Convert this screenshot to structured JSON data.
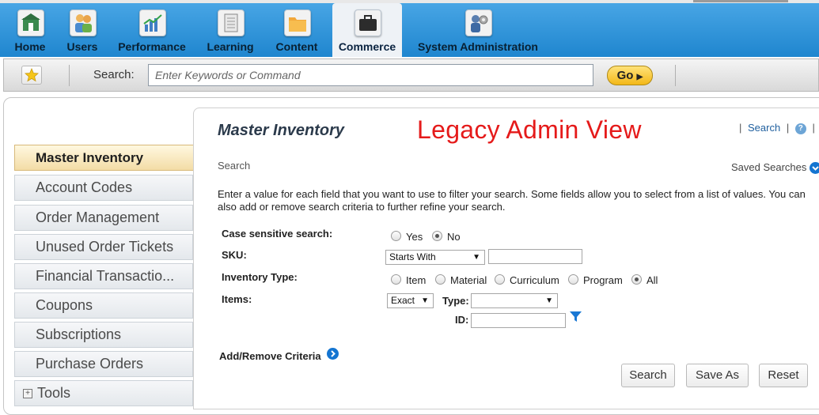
{
  "topnav": {
    "items": [
      {
        "label": "Home",
        "icon": "home-icon"
      },
      {
        "label": "Users",
        "icon": "users-icon"
      },
      {
        "label": "Performance",
        "icon": "performance-icon"
      },
      {
        "label": "Learning",
        "icon": "learning-icon"
      },
      {
        "label": "Content",
        "icon": "content-folder-icon"
      },
      {
        "label": "Commerce",
        "icon": "briefcase-icon"
      },
      {
        "label": "System Administration",
        "icon": "system-admin-icon"
      }
    ],
    "active": "Commerce",
    "colors": {
      "bar": "#2a8fd6",
      "active_tab": "#eef2f6"
    }
  },
  "searchbar": {
    "label": "Search:",
    "placeholder": "Enter Keywords or Command",
    "go_label": "Go",
    "favorite_icon": "star-icon"
  },
  "sidebar": {
    "items": [
      {
        "label": "Master Inventory",
        "active": true
      },
      {
        "label": "Account Codes"
      },
      {
        "label": "Order Management"
      },
      {
        "label": "Unused Order Tickets"
      },
      {
        "label": "Financial Transactio..."
      },
      {
        "label": "Coupons"
      },
      {
        "label": "Subscriptions"
      },
      {
        "label": "Purchase Orders"
      },
      {
        "label": "Tools"
      }
    ],
    "active_color": "#f3dca6"
  },
  "main": {
    "title": "Master Inventory",
    "overlay_title": "Legacy Admin View",
    "overlay_color": "#e51a1a",
    "links": {
      "search": "Search",
      "help_icon": "help-icon"
    },
    "section": "Search",
    "saved_searches": "Saved Searches",
    "instructions": "Enter a value for each field that you want to use to filter your search. Some fields allow you to select from a list of values. You can also add or remove search criteria to further refine your search.",
    "form": {
      "case_sensitive": {
        "label": "Case sensitive search:",
        "options": [
          "Yes",
          "No"
        ],
        "selected": "No"
      },
      "sku": {
        "label": "SKU:",
        "operator": "Starts With",
        "value": ""
      },
      "inventory_type": {
        "label": "Inventory Type:",
        "options": [
          "Item",
          "Material",
          "Curriculum",
          "Program",
          "All"
        ],
        "selected": "All"
      },
      "items": {
        "label": "Items:",
        "operator": "Exact",
        "type_label": "Type:",
        "type_value": "",
        "id_label": "ID:",
        "id_value": ""
      }
    },
    "add_remove": "Add/Remove Criteria",
    "buttons": {
      "search": "Search",
      "save_as": "Save As",
      "reset": "Reset"
    }
  }
}
